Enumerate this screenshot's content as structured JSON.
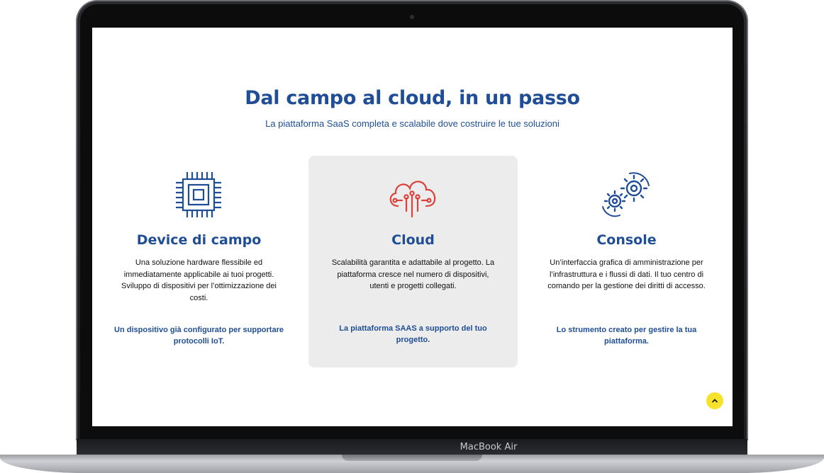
{
  "page": {
    "title": "Dal campo al cloud, in un passo",
    "subtitle": "La piattaforma SaaS completa e scalabile dove costruire le tue soluzioni"
  },
  "cards": [
    {
      "icon": "chip-icon",
      "title": "Device di campo",
      "description": "Una soluzione hardware flessibile ed immediatamente applicabile ai tuoi progetti. Sviluppo di dispositivi per l’ottimizzazione dei costi.",
      "link": "Un dispositivo già configurato per supportare protocolli IoT.",
      "accent": "#1f4e96"
    },
    {
      "icon": "cloud-circuit-icon",
      "title": "Cloud",
      "description": "Scalabilità garantita e adattabile al progetto. La piattaforma cresce nel numero di dispositivi, utenti e progetti collegati.",
      "link": "La piattaforma SAAS a supporto del tuo progetto.",
      "accent": "#d9433c"
    },
    {
      "icon": "gears-icon",
      "title": "Console",
      "description": "Un’interfaccia grafica di amministrazione per l’infrastruttura e i flussi di dati. Il tuo centro di comando per la gestione dei diritti di accesso.",
      "link": "Lo strumento creato per gestire la tua piattaforma.",
      "accent": "#1f4e96"
    }
  ],
  "scroll_top": {
    "icon": "chevron-up-icon",
    "color": "#f6e12b"
  },
  "device": {
    "label": "MacBook Air"
  }
}
